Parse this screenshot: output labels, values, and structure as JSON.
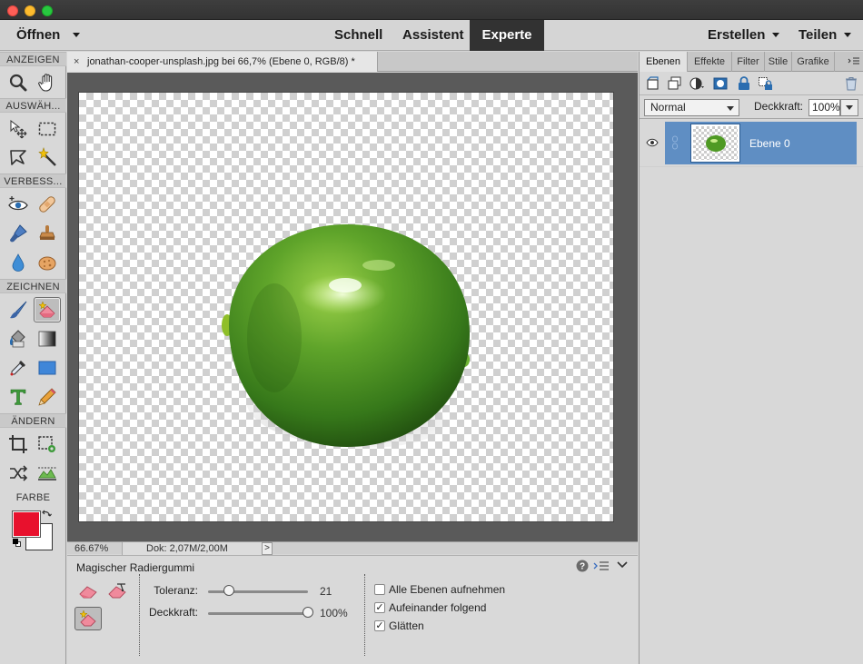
{
  "window": {
    "traffic_lights": [
      "#ff5f57",
      "#febc2e",
      "#28c840"
    ]
  },
  "menubar": {
    "open_label": "Öffnen",
    "modes": [
      "Schnell",
      "Assistent",
      "Experte"
    ],
    "active_mode": "Experte",
    "create_label": "Erstellen",
    "share_label": "Teilen"
  },
  "toolbox": {
    "sections": {
      "view": "ANZEIGEN",
      "select": "AUSWÄH...",
      "enhance": "VERBESS...",
      "draw": "ZEICHNEN",
      "modify": "ÄNDERN",
      "color": "FARBE"
    },
    "foreground_color": "#e8112d",
    "background_color": "#ffffff",
    "active_tool": "magic-eraser-tool"
  },
  "document": {
    "tab_close": "×",
    "tab_title": "jonathan-cooper-unsplash.jpg bei 66,7% (Ebene 0, RGB/8) *"
  },
  "statusbar": {
    "zoom": "66.67%",
    "doc_info": "Dok: 2,07M/2,00M",
    "arrow": ">"
  },
  "tool_options": {
    "title": "Magischer Radiergummi",
    "tolerance_label": "Toleranz:",
    "tolerance_value": "21",
    "tolerance_fraction": 0.21,
    "opacity_label": "Deckkraft:",
    "opacity_value": "100%",
    "opacity_fraction": 1.0,
    "checkboxes": [
      {
        "label": "Alle Ebenen aufnehmen",
        "checked": false
      },
      {
        "label": "Aufeinander folgend",
        "checked": true
      },
      {
        "label": "Glätten",
        "checked": true
      }
    ]
  },
  "panel": {
    "tabs": [
      "Ebenen",
      "Effekte",
      "Filter",
      "Stile",
      "Grafike"
    ],
    "active_tab": "Ebenen",
    "blend_mode": "Normal",
    "opacity_label": "Deckkraft:",
    "opacity_value": "100%",
    "layers": [
      {
        "name": "Ebene 0",
        "visible": true,
        "selected": true
      }
    ]
  }
}
